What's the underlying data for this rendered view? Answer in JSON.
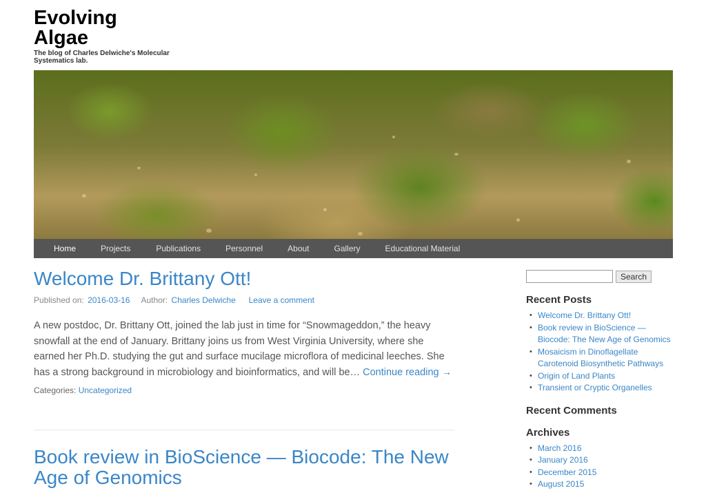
{
  "site": {
    "title_line1": "Evolving",
    "title_line2": "Algae",
    "description": "The blog of Charles Delwiche's Molecular Systematics lab."
  },
  "nav": {
    "items": [
      {
        "label": "Home"
      },
      {
        "label": "Projects"
      },
      {
        "label": "Publications"
      },
      {
        "label": "Personnel"
      },
      {
        "label": "About"
      },
      {
        "label": "Gallery"
      },
      {
        "label": "Educational Material"
      }
    ]
  },
  "posts": [
    {
      "title": "Welcome Dr. Brittany Ott!",
      "published_label": "Published on:",
      "date": "2016-03-16",
      "author_label": "Author:",
      "author": "Charles Delwiche",
      "comment_link": "Leave a comment",
      "excerpt": "A new postdoc, Dr. Brittany Ott, joined the lab just in time for “Snowmageddon,” the heavy snowfall at the end of January. Brittany joins us from West Virginia University, where she earned her Ph.D. studying the gut and surface mucilage microflora of medicinal leeches. She has a strong background in microbiology and bioinformatics, and will be… ",
      "continue_link": "Continue reading →",
      "categories_label": "Categories:",
      "category": "Uncategorized"
    },
    {
      "title": "Book review in BioScience — Biocode: The New Age of Genomics"
    }
  ],
  "sidebar": {
    "search_button": "Search",
    "recent_posts_title": "Recent Posts",
    "recent_posts": [
      "Welcome Dr. Brittany Ott!",
      "Book review in BioScience — Biocode: The New Age of Genomics",
      "Mosaicism in Dinoflagellate Carotenoid Biosynthetic Pathways",
      "Origin of Land Plants",
      "Transient or Cryptic Organelles"
    ],
    "recent_comments_title": "Recent Comments",
    "archives_title": "Archives",
    "archives": [
      "March 2016",
      "January 2016",
      "December 2015",
      "August 2015"
    ]
  }
}
